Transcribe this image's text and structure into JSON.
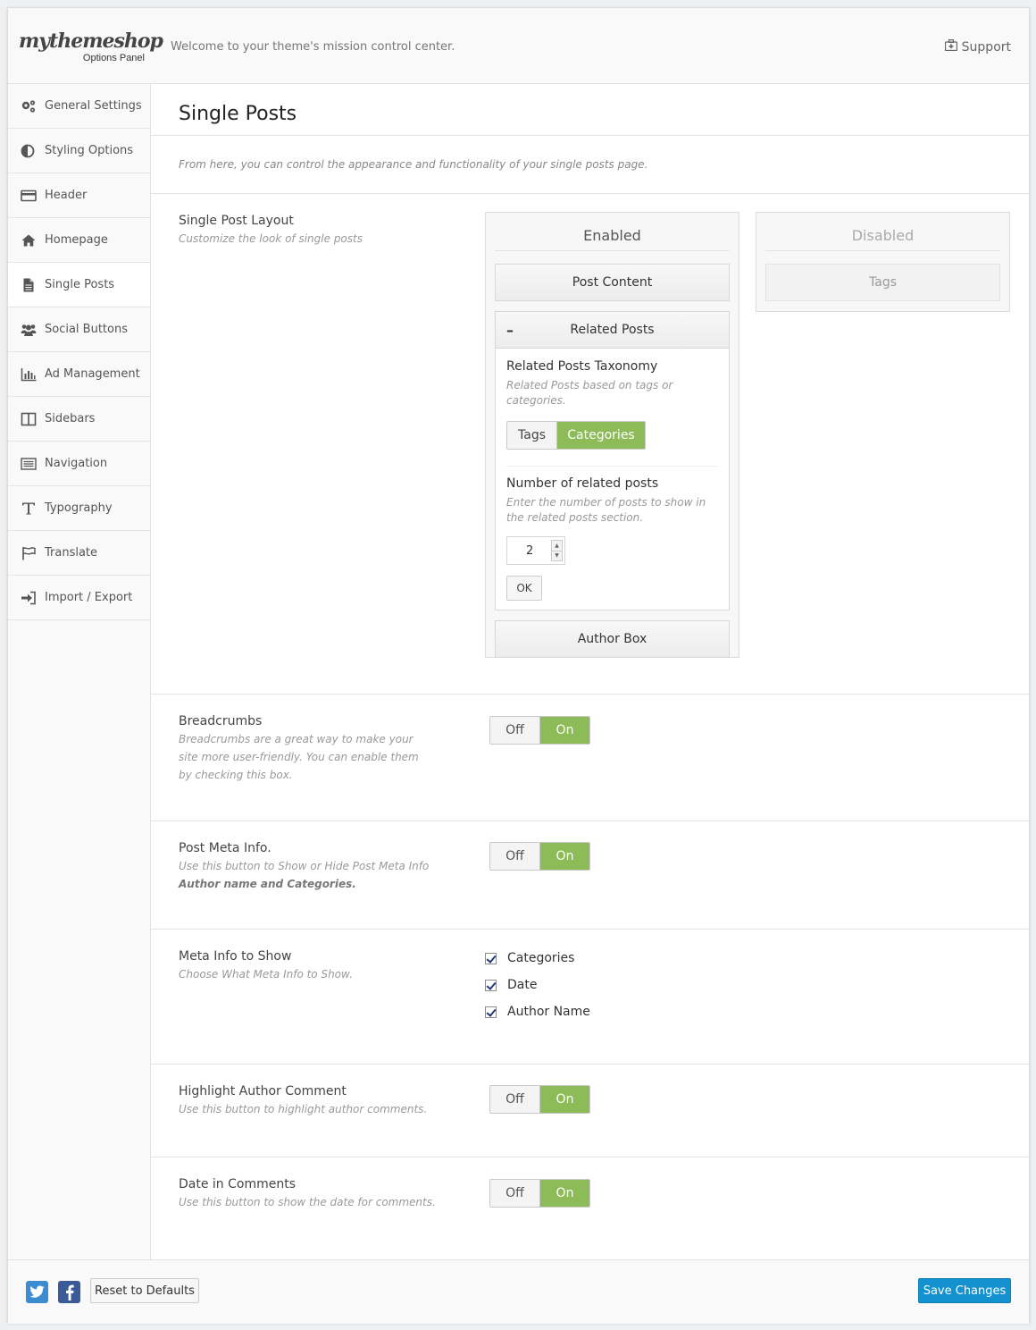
{
  "header": {
    "logo_main": "mythemeshop",
    "logo_sub": "Options Panel",
    "welcome": "Welcome to your theme's mission control center.",
    "support": "Support"
  },
  "sidebar": {
    "items": [
      {
        "label": "General Settings",
        "icon": "gears-icon"
      },
      {
        "label": "Styling Options",
        "icon": "contrast-icon"
      },
      {
        "label": "Header",
        "icon": "card-icon"
      },
      {
        "label": "Homepage",
        "icon": "home-icon"
      },
      {
        "label": "Single Posts",
        "icon": "document-icon",
        "active": true
      },
      {
        "label": "Social Buttons",
        "icon": "users-icon"
      },
      {
        "label": "Ad Management",
        "icon": "bar-chart-icon"
      },
      {
        "label": "Sidebars",
        "icon": "columns-icon"
      },
      {
        "label": "Navigation",
        "icon": "list-icon"
      },
      {
        "label": "Typography",
        "icon": "text-icon"
      },
      {
        "label": "Translate",
        "icon": "flag-icon"
      },
      {
        "label": "Import / Export",
        "icon": "sign-in-icon"
      }
    ]
  },
  "main": {
    "title": "Single Posts",
    "intro": "From here, you can control the appearance and functionality of your single posts page.",
    "layout": {
      "title": "Single Post Layout",
      "desc": "Customize the look of single posts",
      "enabled_label": "Enabled",
      "disabled_label": "Disabled",
      "enabled_items": {
        "post_content": "Post Content",
        "related_posts": "Related Posts",
        "author_box": "Author Box"
      },
      "disabled_items": {
        "tags": "Tags"
      },
      "related": {
        "taxonomy_title": "Related Posts Taxonomy",
        "taxonomy_desc": "Related Posts based on tags or categories.",
        "option_tags": "Tags",
        "option_categories": "Categories",
        "selected": "Categories",
        "number_title": "Number of related posts",
        "number_desc": "Enter the number of posts to show in the related posts section.",
        "number_value": "2",
        "ok_label": "OK"
      }
    },
    "breadcrumbs": {
      "title": "Breadcrumbs",
      "desc": "Breadcrumbs are a great way to make your site more user-friendly. You can enable them by checking this box.",
      "off": "Off",
      "on": "On",
      "value": "On"
    },
    "post_meta": {
      "title": "Post Meta Info.",
      "desc": "Use this button to Show or Hide Post Meta Info",
      "desc_bold": "Author name and Categories.",
      "off": "Off",
      "on": "On",
      "value": "On"
    },
    "meta_show": {
      "title": "Meta Info to Show",
      "desc": "Choose What Meta Info to Show.",
      "options": [
        "Categories",
        "Date",
        "Author Name"
      ],
      "checked": [
        true,
        true,
        true
      ]
    },
    "highlight": {
      "title": "Highlight Author Comment",
      "desc": "Use this button to highlight author comments.",
      "off": "Off",
      "on": "On",
      "value": "On"
    },
    "date_comments": {
      "title": "Date in Comments",
      "desc": "Use this button to show the date for comments.",
      "off": "Off",
      "on": "On",
      "value": "On"
    }
  },
  "footer": {
    "reset": "Reset to Defaults",
    "save": "Save Changes"
  },
  "colors": {
    "accent_green": "#8cbb58",
    "save_blue": "#1392cf",
    "twitter": "#3d8bd0",
    "facebook": "#3b5a98"
  }
}
